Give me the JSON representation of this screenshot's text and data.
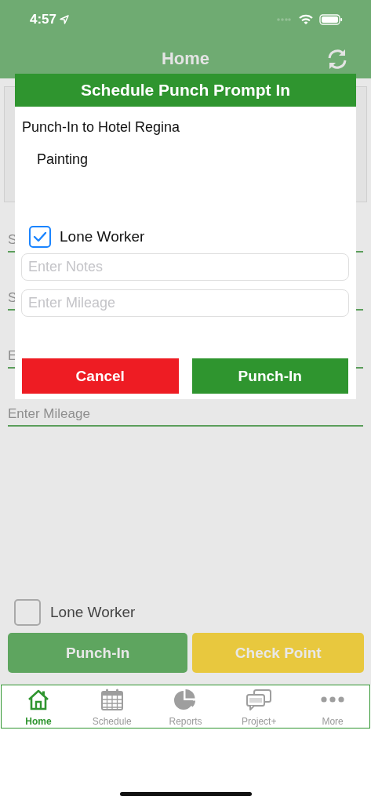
{
  "status_bar": {
    "time": "4:57"
  },
  "nav": {
    "title": "Home"
  },
  "background_form": {
    "fields": [
      {
        "placeholder": "S"
      },
      {
        "placeholder": "S"
      },
      {
        "placeholder": "E"
      },
      {
        "placeholder": "Enter Mileage"
      }
    ]
  },
  "lone_worker": {
    "label": "Lone Worker",
    "checked": false
  },
  "buttons": [
    {
      "label": "Punch-In",
      "kind": "primary"
    },
    {
      "label": "Check Point",
      "kind": "warning"
    }
  ],
  "tabs": [
    {
      "label": "Home",
      "kind": "home",
      "selected": true
    },
    {
      "label": "Schedule",
      "kind": "schedule",
      "selected": false
    },
    {
      "label": "Reports",
      "kind": "reports",
      "selected": false
    },
    {
      "label": "Project+",
      "kind": "project",
      "selected": false
    },
    {
      "label": "More",
      "kind": "more",
      "selected": false
    }
  ],
  "dialog": {
    "title": "Schedule Punch Prompt In",
    "message": "Punch-In to Hotel Regina",
    "task": "Painting",
    "lone_worker": {
      "label": "Lone Worker",
      "checked": true
    },
    "fields": [
      {
        "placeholder": "Enter Notes"
      },
      {
        "placeholder": "Enter Mileage"
      }
    ],
    "buttons": [
      {
        "label": "Cancel",
        "kind": "cancel"
      },
      {
        "label": "Punch-In",
        "kind": "confirm"
      }
    ]
  }
}
